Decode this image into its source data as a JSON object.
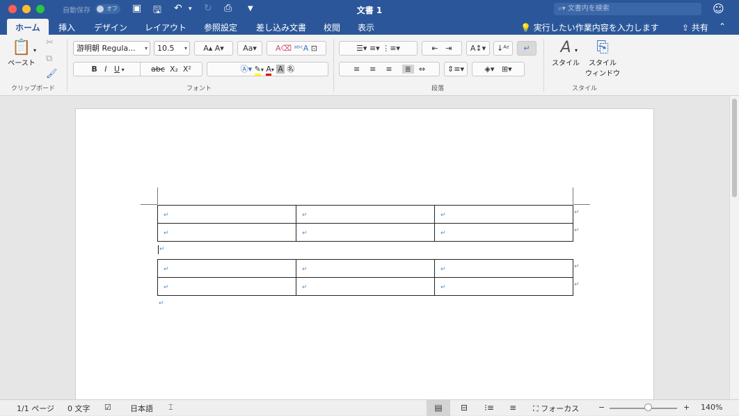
{
  "window": {
    "title": "文書 1",
    "autosave_label": "自動保存",
    "autosave_state": "オフ",
    "search_placeholder": "文書内を検索"
  },
  "tabs": [
    "ホーム",
    "挿入",
    "デザイン",
    "レイアウト",
    "参照設定",
    "差し込み文書",
    "校閲",
    "表示"
  ],
  "active_tab": "ホーム",
  "tell_me": "実行したい作業内容を入力します",
  "share_label": "共有",
  "ribbon": {
    "clipboard": {
      "paste_label": "ペースト",
      "group_label": "クリップボード"
    },
    "font": {
      "font_name": "游明朝 Regula...",
      "font_size": "10.5",
      "group_label": "フォント",
      "highlight_color": "#ffff00",
      "font_color": "#e00000"
    },
    "paragraph": {
      "group_label": "段落"
    },
    "styles": {
      "styles_label": "スタイル",
      "pane_label_1": "スタイル",
      "pane_label_2": "ウィンドウ",
      "group_label": "スタイル"
    }
  },
  "document": {
    "tables": [
      {
        "rows": [
          [
            "↵",
            "↵",
            "↵"
          ],
          [
            "↵",
            "↵",
            "↵"
          ]
        ]
      },
      {
        "rows": [
          [
            "↵",
            "↵",
            "↵"
          ],
          [
            "↵",
            "↵",
            "↵"
          ]
        ]
      }
    ],
    "paragraph_mark": "↵"
  },
  "status": {
    "page": "1/1 ページ",
    "words": "0 文字",
    "language": "日本語",
    "focus_label": "フォーカス",
    "zoom": "140%"
  }
}
